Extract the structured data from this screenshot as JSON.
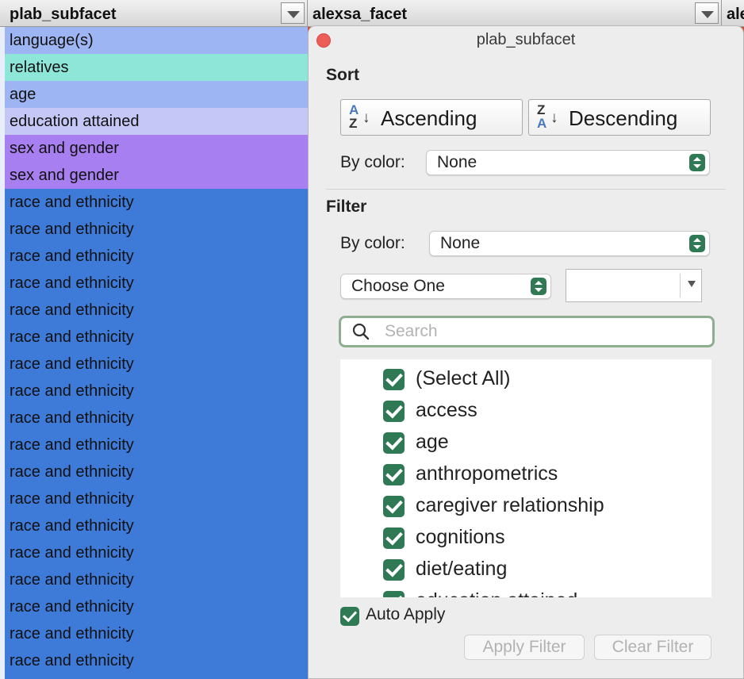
{
  "header": {
    "col1_title": "plab_subfacet",
    "col2_title": "alexsa_facet",
    "col3_title": "ale"
  },
  "column_cells": [
    {
      "text": "language(s)",
      "color": "#9db5f2"
    },
    {
      "text": "relatives",
      "color": "#8ee6d8"
    },
    {
      "text": "age",
      "color": "#9db5f2"
    },
    {
      "text": "education attained",
      "color": "#c5c7f6"
    },
    {
      "text": "sex and gender",
      "color": "#a87ff0"
    },
    {
      "text": "sex and gender",
      "color": "#a87ff0"
    },
    {
      "text": "race and ethnicity",
      "color": "#3e7bd9"
    },
    {
      "text": "race and ethnicity",
      "color": "#3e7bd9"
    },
    {
      "text": "race and ethnicity",
      "color": "#3e7bd9"
    },
    {
      "text": "race and ethnicity",
      "color": "#3e7bd9"
    },
    {
      "text": "race and ethnicity",
      "color": "#3e7bd9"
    },
    {
      "text": "race and ethnicity",
      "color": "#3e7bd9"
    },
    {
      "text": "race and ethnicity",
      "color": "#3e7bd9"
    },
    {
      "text": "race and ethnicity",
      "color": "#3e7bd9"
    },
    {
      "text": "race and ethnicity",
      "color": "#3e7bd9"
    },
    {
      "text": "race and ethnicity",
      "color": "#3e7bd9"
    },
    {
      "text": "race and ethnicity",
      "color": "#3e7bd9"
    },
    {
      "text": "race and ethnicity",
      "color": "#3e7bd9"
    },
    {
      "text": "race and ethnicity",
      "color": "#3e7bd9"
    },
    {
      "text": "race and ethnicity",
      "color": "#3e7bd9"
    },
    {
      "text": "race and ethnicity",
      "color": "#3e7bd9"
    },
    {
      "text": "race and ethnicity",
      "color": "#3e7bd9"
    },
    {
      "text": "race and ethnicity",
      "color": "#3e7bd9"
    },
    {
      "text": "race and ethnicity",
      "color": "#3e7bd9"
    }
  ],
  "popover": {
    "title": "plab_subfacet",
    "sort": {
      "heading": "Sort",
      "ascending_label": "Ascending",
      "ascending_icon_top": "A",
      "ascending_icon_bottom": "Z",
      "descending_label": "Descending",
      "descending_icon_top": "Z",
      "descending_icon_bottom": "A",
      "by_color_label": "By color:",
      "by_color_value": "None"
    },
    "filter": {
      "heading": "Filter",
      "by_color_label": "By color:",
      "by_color_value": "None",
      "condition_value": "Choose One",
      "condition_text_value": "",
      "search_placeholder": "Search",
      "items": [
        {
          "label": "(Select All)",
          "checked": true
        },
        {
          "label": "access",
          "checked": true
        },
        {
          "label": "age",
          "checked": true
        },
        {
          "label": "anthropometrics",
          "checked": true
        },
        {
          "label": "caregiver relationship",
          "checked": true
        },
        {
          "label": "cognitions",
          "checked": true
        },
        {
          "label": "diet/eating",
          "checked": true
        },
        {
          "label": "education attained",
          "checked": true
        }
      ],
      "auto_apply_label": "Auto Apply",
      "auto_apply_checked": true,
      "apply_label": "Apply Filter",
      "clear_label": "Clear Filter"
    }
  },
  "colors": {
    "accent_green": "#2f7a54",
    "close_red": "#ec5e57",
    "neighbor_column": "#d9472b"
  },
  "icons": {
    "close": "close-dot-icon",
    "search": "magnifier-icon",
    "dropdown": "triangle-down-icon",
    "stepper": "up-down-stepper-icon",
    "checkbox": "checkmark-icon"
  }
}
